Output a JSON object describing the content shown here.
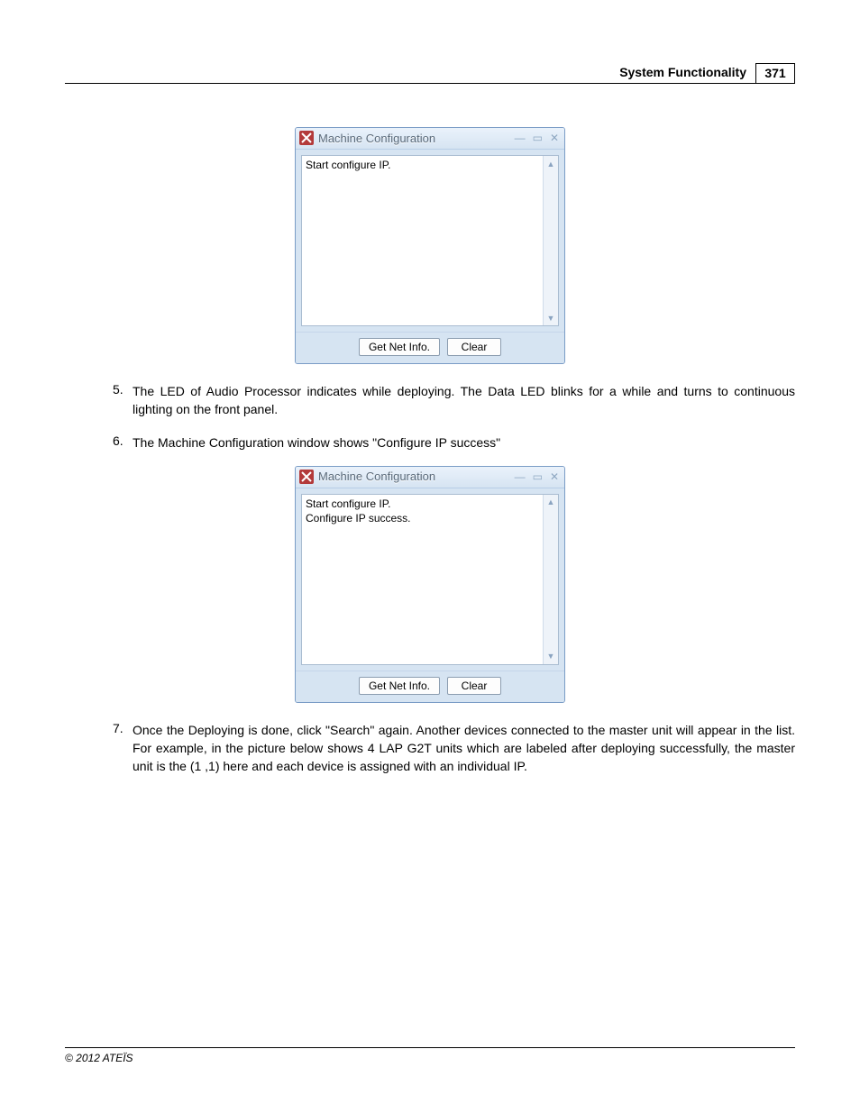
{
  "header": {
    "title": "System Functionality",
    "page_number": "371"
  },
  "window1": {
    "title": "Machine Configuration",
    "content": "Start configure IP.",
    "btn_get": "Get Net Info.",
    "btn_clear": "Clear"
  },
  "items": {
    "n5": "5.",
    "t5": "The LED of Audio Processor indicates while deploying. The Data LED blinks for a while and turns to continuous lighting on the front panel.",
    "n6": "6.",
    "t6": "The Machine Configuration window shows \"Configure IP success\"",
    "n7": "7.",
    "t7": "Once the Deploying is done, click \"Search\" again. Another devices connected to the master unit will appear in the list. For example, in the picture below shows 4 LAP G2T units which are labeled after deploying successfully, the master unit is the (1 ,1) here and each device is assigned with an individual IP."
  },
  "window2": {
    "title": "Machine Configuration",
    "content": "Start configure IP.\nConfigure IP success.",
    "btn_get": "Get Net Info.",
    "btn_clear": "Clear"
  },
  "footer": {
    "copyright": "© 2012 ATEÏS"
  }
}
